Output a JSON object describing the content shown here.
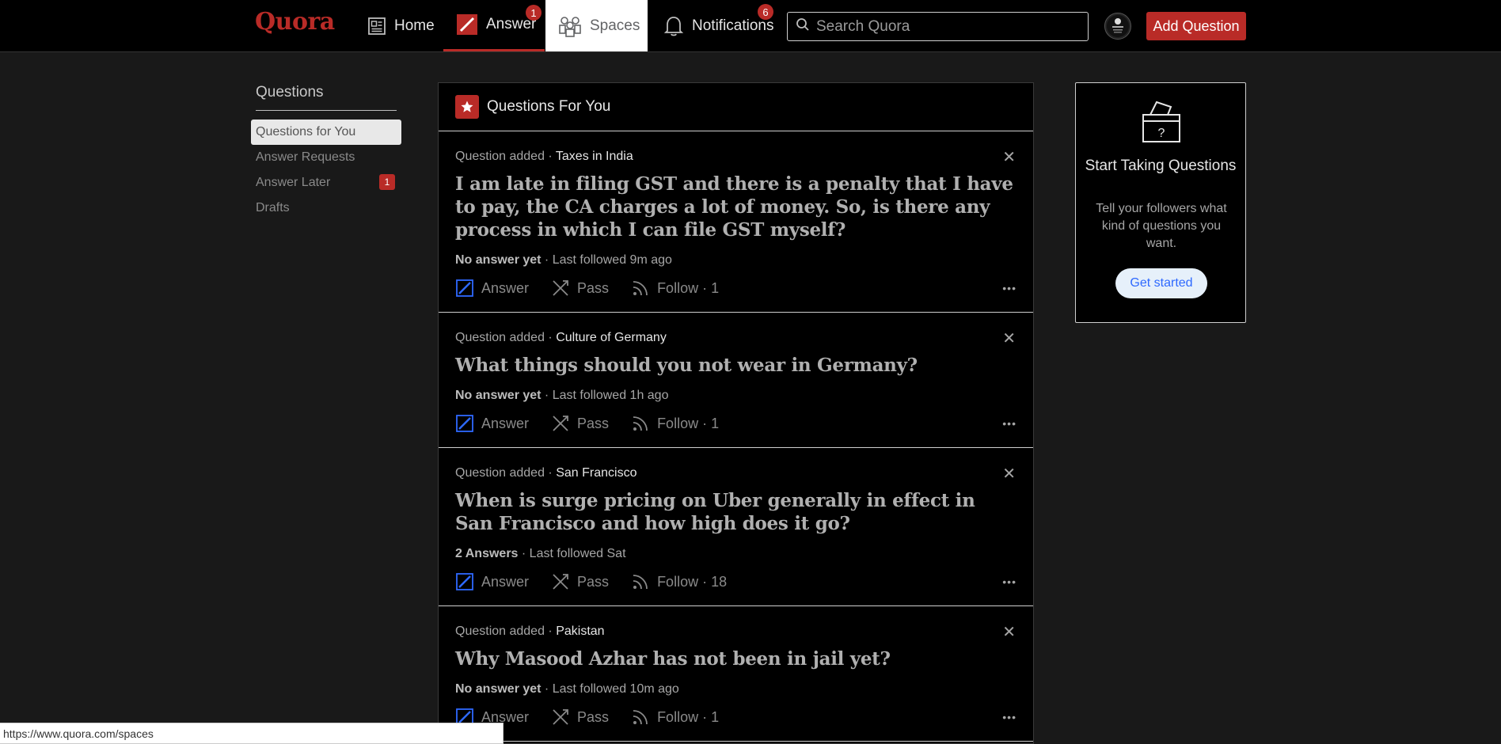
{
  "header": {
    "logo": "Quora",
    "nav": {
      "home": "Home",
      "answer": "Answer",
      "answer_badge": "1",
      "spaces": "Spaces",
      "notifications": "Notifications",
      "notifications_badge": "6"
    },
    "search_placeholder": "Search Quora",
    "add_question": "Add Question"
  },
  "sidebar": {
    "title": "Questions",
    "items": [
      {
        "label": "Questions for You"
      },
      {
        "label": "Answer Requests"
      },
      {
        "label": "Answer Later",
        "badge": "1"
      },
      {
        "label": "Drafts"
      }
    ]
  },
  "feed": {
    "title": "Questions For You",
    "cards": [
      {
        "meta_prefix": "Question added · ",
        "topic": "Taxes in India",
        "title": "I am late in filing GST and there is a penalty that I have to pay, the CA charges a lot of money. So, is there any process in which I can file GST myself?",
        "status": "No answer yet",
        "followed": " · Last followed 9m ago",
        "follow": "Follow · 1"
      },
      {
        "meta_prefix": "Question added · ",
        "topic": "Culture of Germany",
        "title": "What things should you not wear in Germany?",
        "status": "No answer yet",
        "followed": " · Last followed 1h ago",
        "follow": "Follow · 1"
      },
      {
        "meta_prefix": "Question added · ",
        "topic": "San Francisco",
        "title": "When is surge pricing on Uber generally in effect in San Francisco and how high does it go?",
        "status": "2 Answers",
        "followed": " · Last followed Sat",
        "follow": "Follow · 18"
      },
      {
        "meta_prefix": "Question added · ",
        "topic": "Pakistan",
        "title": "Why Masood Azhar has not been in jail yet?",
        "status": "No answer yet",
        "followed": " · Last followed 10m ago",
        "follow": "Follow · 1"
      }
    ],
    "actions": {
      "answer": "Answer",
      "pass": "Pass",
      "more": "•••",
      "close": "✕"
    }
  },
  "right_box": {
    "title": "Start Taking Questions",
    "subtitle": "Tell your followers what kind of questions you want.",
    "button": "Get started"
  },
  "status_bar": "https://www.quora.com/spaces",
  "colors": {
    "brand": "#b92b27",
    "link": "#2e69ff"
  }
}
